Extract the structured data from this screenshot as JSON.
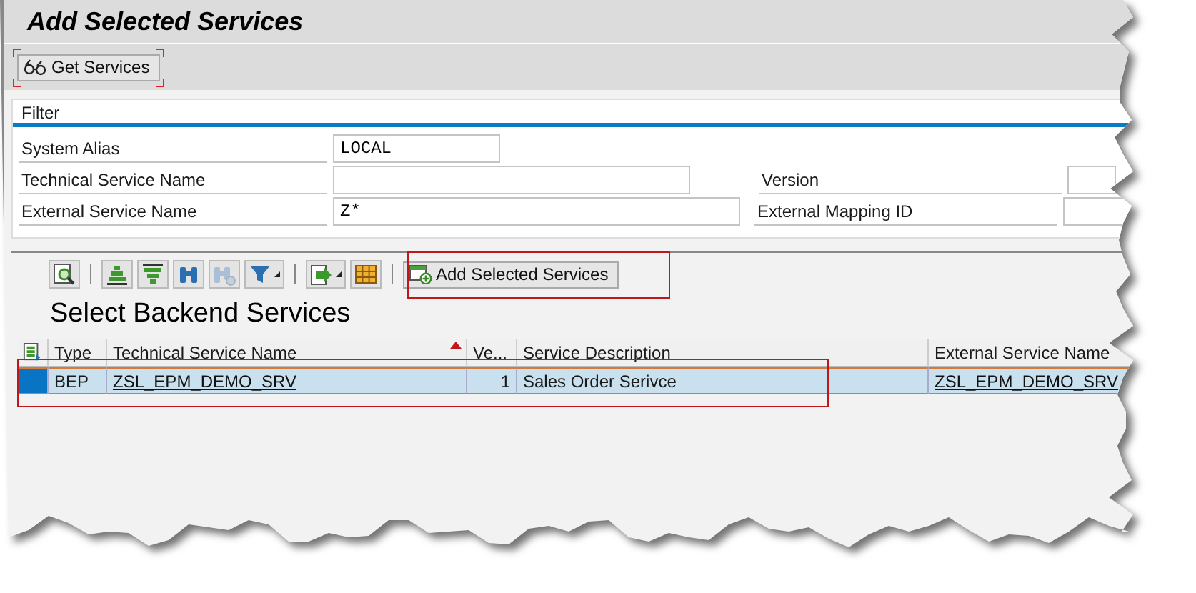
{
  "window": {
    "title": "Add Selected Services"
  },
  "toolbar": {
    "buttons": [
      {
        "label": "Get Services",
        "kind": "glasses",
        "focused": true
      }
    ]
  },
  "filter": {
    "title": "Filter",
    "rows": [
      [
        {
          "label": "System Alias",
          "value": "LOCAL"
        }
      ],
      [
        {
          "label": "Technical Service Name"
        },
        {
          "label": "Version"
        }
      ],
      [
        {
          "label": "External Service Name",
          "value": "Z*"
        },
        {
          "label": "External Mapping ID"
        }
      ]
    ]
  },
  "alv": {
    "tools": [
      {
        "kind": "details",
        "disabled": false,
        "dropdown": false
      },
      {
        "kind": "sort-up",
        "disabled": false,
        "dropdown": false
      },
      {
        "kind": "sort-down",
        "disabled": false,
        "dropdown": false
      },
      {
        "kind": "find",
        "disabled": false,
        "dropdown": false
      },
      {
        "kind": "find-next",
        "disabled": true,
        "dropdown": false
      },
      {
        "kind": "filter",
        "disabled": false,
        "dropdown": true
      },
      {
        "kind": "export",
        "disabled": false,
        "dropdown": true
      },
      {
        "kind": "layout",
        "disabled": false,
        "dropdown": false
      }
    ],
    "action": {
      "label": "Add Selected Services",
      "annotated": true
    },
    "title": "Select Backend Services",
    "columns": [
      {
        "label": "Type",
        "kind": "text",
        "sorted": false
      },
      {
        "label": "Technical Service Name",
        "kind": "link",
        "sorted": true
      },
      {
        "label": "Ve...",
        "kind": "number",
        "sorted": false
      },
      {
        "label": "Service Description",
        "kind": "text",
        "sorted": false
      },
      {
        "label": "External Service Name",
        "kind": "link",
        "sorted": false
      }
    ],
    "rows": [
      {
        "selected": true,
        "annotated": true,
        "cells": [
          "BEP",
          "ZSL_EPM_DEMO_SRV",
          "1",
          "Sales Order Serivce",
          "ZSL_EPM_DEMO_SRV"
        ]
      }
    ]
  }
}
